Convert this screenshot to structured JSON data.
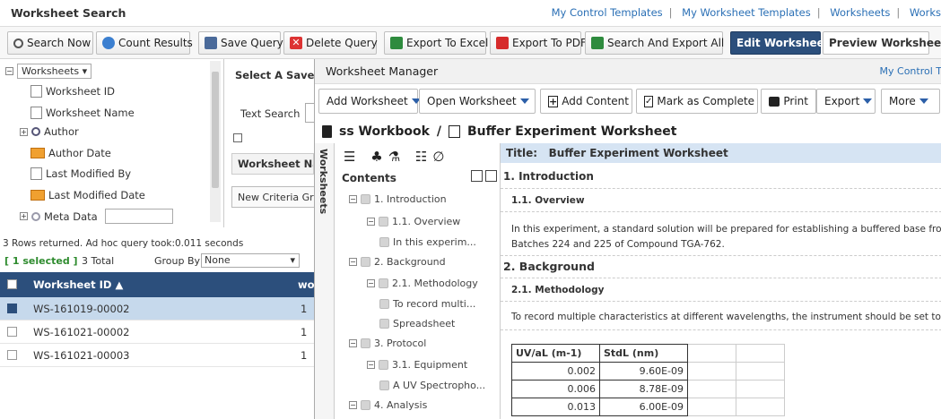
{
  "header": {
    "title": "Worksheet Search",
    "links": [
      "My Control Templates",
      "My Worksheet Templates",
      "Worksheets",
      "Works"
    ]
  },
  "toolbar": {
    "search_now": "Search Now",
    "count_results": "Count Results",
    "save_query": "Save Query",
    "delete_query": "Delete Query",
    "export_excel": "Export To Excel",
    "export_pdf": "Export To PDF",
    "search_export_all": "Search And Export All",
    "edit_worksheet": "Edit Worksheet",
    "preview_worksheet": "Preview Worksheet"
  },
  "tree": {
    "root": "Worksheets",
    "items": [
      "Worksheet ID",
      "Worksheet Name",
      "Author",
      "Author Date",
      "Last Modified By",
      "Last Modified Date",
      "Meta Data"
    ]
  },
  "center": {
    "saved_label": "Select A Saved C",
    "text_search": "Text Search",
    "field": "Worksheet Nam",
    "new_group": "New Criteria Gro"
  },
  "results": {
    "status": "3 Rows returned. Ad hoc query took:0.011 seconds",
    "selected": "[ 1 selected ]",
    "total": "3 Total",
    "group_by_label": "Group By",
    "group_by_value": "None",
    "col1": "Worksheet ID",
    "col2": "wo",
    "rows": [
      {
        "id": "WS-161019-00002",
        "v": "1",
        "selected": true
      },
      {
        "id": "WS-161021-00002",
        "v": "1",
        "selected": false
      },
      {
        "id": "WS-161021-00003",
        "v": "1",
        "selected": false
      }
    ]
  },
  "wm": {
    "title": "Worksheet Manager",
    "link": "My Control T",
    "buttons": {
      "add": "Add Worksheet",
      "open": "Open Worksheet",
      "add_content": "Add Content",
      "mark_complete": "Mark as Complete",
      "print": "Print",
      "export": "Export",
      "more": "More"
    },
    "breadcrumb": {
      "workbook": "ss Workbook",
      "sep": "/",
      "worksheet": "Buffer Experiment Worksheet"
    }
  },
  "side_tab": "Worksheets",
  "toc": {
    "title": "Contents",
    "items": [
      "1. Introduction",
      "1.1. Overview",
      "In this experim...",
      "2. Background",
      "2.1. Methodology",
      "To record multi...",
      "Spreadsheet",
      "3. Protocol",
      "3.1. Equipment",
      "A UV Spectropho...",
      "4. Analysis"
    ]
  },
  "doc": {
    "title_label": "Title:",
    "title_value": "Buffer Experiment Worksheet",
    "h1": "1.  Introduction",
    "h11": "1.1.  Overview",
    "p1": "In this experiment, a standard solution will be prepared for establishing a buffered base from p",
    "p1b": "Batches 224 and 225 of Compound TGA-762.",
    "h2": "2.  Background",
    "h21": "2.1.  Methodology",
    "p2": "To record multiple characteristics at different wavelengths, the instrument should be set to the",
    "table": {
      "headers": [
        "UV/aL (m-1)",
        "StdL (nm)"
      ],
      "rows": [
        [
          "0.002",
          "9.60E-09"
        ],
        [
          "0.006",
          "8.78E-09"
        ],
        [
          "0.013",
          "6.00E-09"
        ]
      ]
    }
  }
}
